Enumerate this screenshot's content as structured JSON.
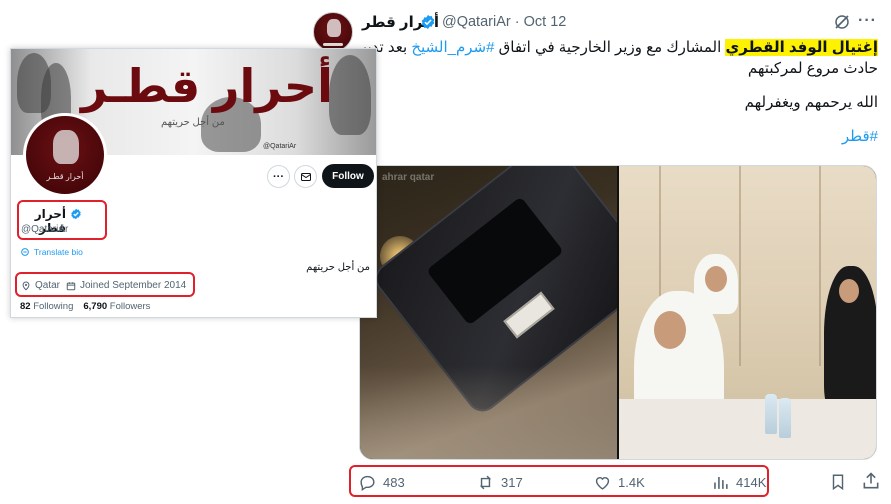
{
  "tweet": {
    "author_name": "أحرار قطر",
    "handle": "@QatariAr",
    "date": "Oct 12",
    "handle_date_sep": " · ",
    "text_highlight": "إغتيال الوفد القطري",
    "text_rest_1": " المشارك مع وزير الخارجية في اتفاق ",
    "text_tag_1": "#شرم_الشيخ",
    "text_rest_2": " بعد تدبير",
    "text_line_2": "حادث مروع لمركبتهم",
    "text_line_3": "الله يرحمهم ويغفرلهم",
    "text_tag_2": "#قطر"
  },
  "media": {
    "watermark": "ahrar qatar"
  },
  "actions": {
    "replies": "483",
    "reposts": "317",
    "likes": "1.4K",
    "views": "414K"
  },
  "profile_card": {
    "banner_title": "أحرار قطـر",
    "banner_subtitle": "من أجل حريتهم",
    "banner_handle": "@QatariAr",
    "avatar_label": "أحرار قطـر",
    "follow_label": "Follow",
    "more_label": "···",
    "name": "أحرار قطر",
    "handle": "@QatariAr",
    "translate_label": "Translate bio",
    "bio": "من أجل حريتهم",
    "location": "Qatar",
    "joined": "Joined September 2014",
    "following_count": "82",
    "following_label": "Following",
    "followers_count": "6,790",
    "followers_label": "Followers"
  },
  "colors": {
    "accent": "#1d9bf0",
    "highlight": "#fff200",
    "annotation_red": "#e0202a",
    "brand_maroon": "#6b0b0f"
  }
}
